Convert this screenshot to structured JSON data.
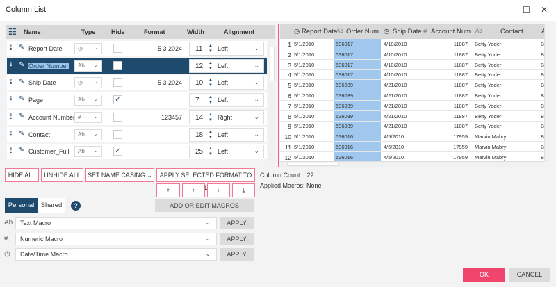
{
  "window": {
    "title": "Column List",
    "minimize_icon": "maximize-icon",
    "close_icon": "close-icon"
  },
  "columns_editor": {
    "headers": {
      "name": "Name",
      "type": "Type",
      "hide": "Hide",
      "format": "Format",
      "width": "Width",
      "alignment": "Alignment"
    },
    "rows": [
      {
        "name": "Report Date",
        "type": "clock",
        "format": "5 3 2024",
        "width": "11",
        "hidden": false,
        "alignment": "Left"
      },
      {
        "name": "Order Number",
        "type": "Ab",
        "format": "",
        "width": "12",
        "hidden": false,
        "alignment": "Left",
        "selected": true
      },
      {
        "name": "Ship Date",
        "type": "clock",
        "format": "5 3 2024",
        "width": "10",
        "hidden": false,
        "alignment": "Left"
      },
      {
        "name": "Page",
        "type": "Ab",
        "format": "",
        "width": "7",
        "hidden": true,
        "alignment": "Left"
      },
      {
        "name": "Account Number",
        "type": "#",
        "format": "123457",
        "width": "14",
        "hidden": false,
        "alignment": "Right"
      },
      {
        "name": "Contact",
        "type": "Ab",
        "format": "",
        "width": "18",
        "hidden": false,
        "alignment": "Left"
      },
      {
        "name": "Customer_Full",
        "type": "Ab",
        "format": "",
        "width": "25",
        "hidden": true,
        "alignment": "Left"
      }
    ]
  },
  "preview": {
    "headers": [
      "Report Date",
      "Order Num...",
      "Ship Date",
      "Account Num...",
      "Contact",
      "A"
    ],
    "rows": [
      [
        "1",
        "5/1/2010",
        "536017",
        "4/10/2010",
        "11887",
        "Betty Yoder",
        "B"
      ],
      [
        "2",
        "5/1/2010",
        "536017",
        "4/10/2010",
        "11887",
        "Betty Yoder",
        "B"
      ],
      [
        "3",
        "5/1/2010",
        "536017",
        "4/10/2010",
        "11887",
        "Betty Yoder",
        "B"
      ],
      [
        "4",
        "5/1/2010",
        "536017",
        "4/10/2010",
        "11887",
        "Betty Yoder",
        "B"
      ],
      [
        "5",
        "5/1/2010",
        "536039",
        "4/21/2010",
        "11887",
        "Betty Yoder",
        "B"
      ],
      [
        "6",
        "5/1/2010",
        "536039",
        "4/21/2010",
        "11887",
        "Betty Yoder",
        "B"
      ],
      [
        "7",
        "5/1/2010",
        "536039",
        "4/21/2010",
        "11887",
        "Betty Yoder",
        "B"
      ],
      [
        "8",
        "5/1/2010",
        "536039",
        "4/21/2010",
        "11887",
        "Betty Yoder",
        "B"
      ],
      [
        "9",
        "5/1/2010",
        "536039",
        "4/21/2010",
        "11887",
        "Betty Yoder",
        "B"
      ],
      [
        "10",
        "5/1/2010",
        "536016",
        "4/5/2010",
        "17959",
        "Marvin Mabry",
        "B"
      ],
      [
        "11",
        "5/1/2010",
        "536016",
        "4/5/2010",
        "17959",
        "Marvin Mabry",
        "B"
      ],
      [
        "12",
        "5/1/2010",
        "536016",
        "4/5/2010",
        "17959",
        "Marvin Mabry",
        "B"
      ]
    ]
  },
  "actions": {
    "hide_all": "HIDE ALL",
    "unhide_all": "UNHIDE ALL",
    "set_name_casing": "SET NAME CASING",
    "apply_format": "APPLY SELECTED FORMAT TO ALL"
  },
  "info": {
    "column_count_label": "Column Count:",
    "column_count": "22",
    "applied_macros_label": "Applied Macros:",
    "applied_macros": "None"
  },
  "macros": {
    "tab_personal": "Personal",
    "tab_shared": "Shared",
    "help": "?",
    "add_edit": "ADD OR EDIT MACROS",
    "items": [
      {
        "icon": "Ab",
        "value": "Text Macro",
        "apply": "APPLY"
      },
      {
        "icon": "#",
        "value": "Numeric Macro",
        "apply": "APPLY"
      },
      {
        "icon": "clock",
        "value": "Date/Time Macro",
        "apply": "APPLY"
      }
    ]
  },
  "footer": {
    "ok": "OK",
    "cancel": "CANCEL"
  },
  "colors": {
    "accent": "#1e4a6e",
    "ok_button": "#f0466e",
    "selected_column": "#a0c8ee",
    "border_pink": "#f07a95"
  }
}
